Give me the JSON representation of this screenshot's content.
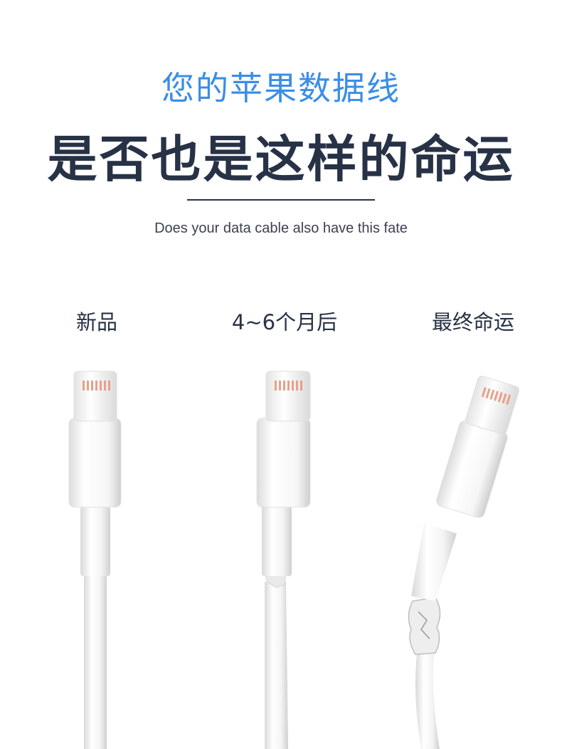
{
  "header": {
    "subtitle": "您的苹果数据线",
    "headline": "是否也是这样的命运",
    "english": "Does your data cable also have this fate"
  },
  "stages": [
    {
      "label": "新品"
    },
    {
      "label": "4~6个月后"
    },
    {
      "label": "最终命运"
    }
  ],
  "colors": {
    "subtitle": "#3a8ee6",
    "headline": "#283246",
    "cable": "#f3f3f3",
    "contacts": "#e8a08a"
  }
}
